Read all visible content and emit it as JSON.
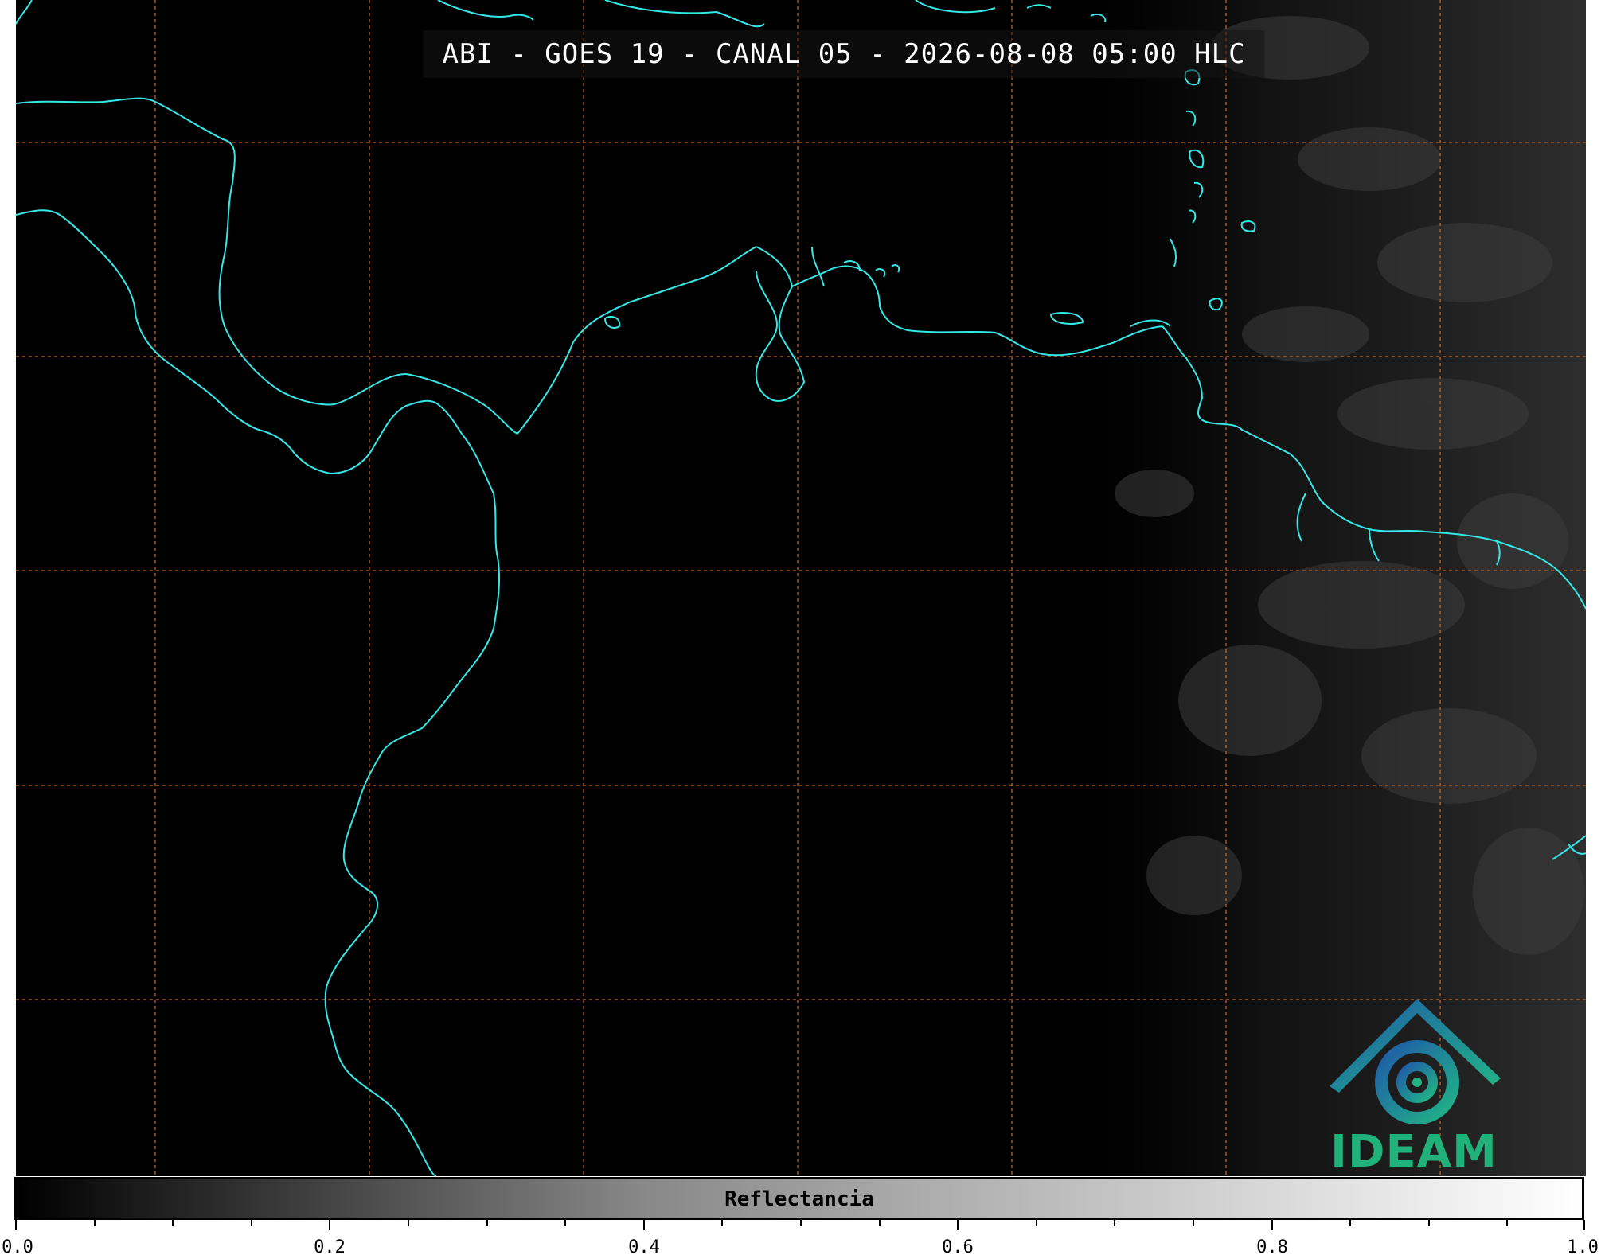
{
  "title": "ABI - GOES 19 - CANAL 05 - 2026-08-08 05:00 HLC",
  "logo": {
    "text": "IDEAM",
    "icon": "ideam-logo-icon"
  },
  "colorbar": {
    "label": "Reflectancia",
    "ticks": [
      "0.0",
      "0.2",
      "0.4",
      "0.6",
      "0.8",
      "1.0"
    ],
    "range": [
      0.0,
      1.0
    ],
    "colormap": "grayscale"
  },
  "colors": {
    "coastline": "#35e8e8",
    "gridline": "#d2691e",
    "background": "#000000"
  }
}
